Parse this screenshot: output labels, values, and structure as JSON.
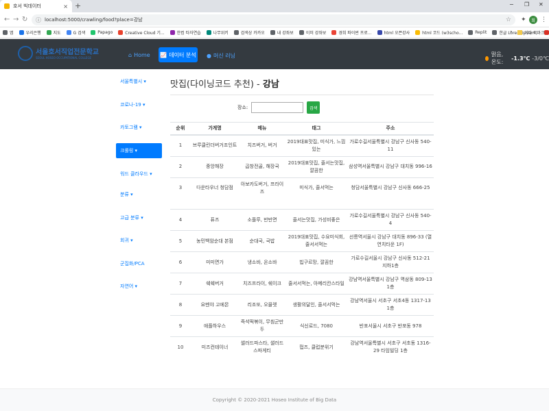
{
  "browser": {
    "tab_title": "호서 빅데이터",
    "tab_close": "×",
    "new_tab": "+",
    "url": "localhost:5000/crawling/food?place=강남",
    "window_minimize": "−",
    "window_restore": "❐",
    "window_close": "✕",
    "profile_initial": "희",
    "bookmarks": [
      {
        "label": "앱",
        "color": "#5f6368"
      },
      {
        "label": "우리은행",
        "color": "#1a73e8"
      },
      {
        "label": "지도",
        "color": "#34a853"
      },
      {
        "label": "G 검색",
        "color": "#4285f4"
      },
      {
        "label": "Papago",
        "color": "#21c56d"
      },
      {
        "label": "Creative Cloud 기...",
        "color": "#e8412c"
      },
      {
        "label": "한컴 타자연습",
        "color": "#8e24aa"
      },
      {
        "label": "나무위키",
        "color": "#00897b"
      },
      {
        "label": "검색상 카카오",
        "color": "#5f6368"
      },
      {
        "label": "내 강좌보",
        "color": "#5f6368"
      },
      {
        "label": "이미 강좌보",
        "color": "#5f6368"
      },
      {
        "label": "경희 파이썬 프로...",
        "color": "#ea4335"
      },
      {
        "label": "html 오픈강사",
        "color": "#3949ab"
      },
      {
        "label": "html 코드 (w3scho...",
        "color": "#fbbc04"
      },
      {
        "label": "Replit",
        "color": "#5f6368"
      },
      {
        "label": "한글 Lorem Ipsum...",
        "color": "#5f6368"
      },
      {
        "label": "ppt",
        "color": "#d93025"
      }
    ],
    "bookmarks_more": "»",
    "other_bookmarks": "기타 북마크"
  },
  "navbar": {
    "logo_ko": "서울호서직업전문학교",
    "logo_en": "SEOUL HOSEO OCCUPATIONAL COLLEGE",
    "home_label": "Home",
    "data_analysis_label": "데이터 분석",
    "ml_label": "머신 러닝",
    "weather_label": "맑음, 온도:",
    "temp_now": "-1.3℃",
    "temp_low": "-3/0℃"
  },
  "sidebar": {
    "items": [
      {
        "label": "서울특별시 ▾"
      },
      {
        "label": "코로나-19 ▾"
      },
      {
        "label": "카토그램 ▾"
      },
      {
        "label": "크롤링 ▾"
      },
      {
        "label": "워드 클라우드 ▾"
      },
      {
        "label": "분류 ▾"
      },
      {
        "label": "고급 분류 ▾"
      },
      {
        "label": "회귀 ▾"
      },
      {
        "label": "군집화/PCA"
      },
      {
        "label": "자연어 ▾"
      }
    ]
  },
  "main": {
    "title_prefix": "맛집(다이닝코드 추천) - ",
    "title_place": "강남",
    "search_label": "장소:",
    "search_value": "",
    "search_button": "검색",
    "columns": [
      "순위",
      "가게명",
      "메뉴",
      "태그",
      "주소"
    ],
    "rows_top": [
      {
        "rank": "1",
        "name": "브루클린더버거조인트",
        "menu": "치즈버거, 버거",
        "tags": "2019대표맛집, 미식가, 느낌있는",
        "addr": "가로수길서울특별시 강남구 신사동 540-11"
      },
      {
        "rank": "2",
        "name": "중앙해장",
        "menu": "곱창전골, 해장국",
        "tags": "2019대표맛집, 줄서는맛집, 깔끔한",
        "addr": "삼성역서울특별시 강남구 대치동 996-16"
      },
      {
        "rank": "3",
        "name": "다운타우너 청담점",
        "menu": "아보카도버거, 프라이즈",
        "tags": "미식가, 줄서먹는",
        "addr": "청담서울특별시 강남구 신사동 666-25"
      }
    ],
    "rows_bottom": [
      {
        "rank": "4",
        "name": "퓨즈",
        "menu": "소플루, 반반면",
        "tags": "줄서는맛집, 가성비좋은",
        "addr": "가로수길서울특별시 강남구 신사동 540-4"
      },
      {
        "rank": "5",
        "name": "농민백암순대 본점",
        "menu": "순대국, 국밥",
        "tags": "2019대표맛집, 수요미식회, 줄서서먹는",
        "addr": "선릉역서울시 강남구 대치동 896-33 (열연치타운 1F)"
      },
      {
        "rank": "6",
        "name": "미미면가",
        "menu": "냉소바, 온소바",
        "tags": "빕구르망, 깔끔한",
        "addr": "가로수길서울시 강남구 신사동 512-21 지하1층"
      },
      {
        "rank": "7",
        "name": "쉑쉑버거",
        "menu": "치즈프라이, 쉐이크",
        "tags": "줄서서먹는, 아메리칸스타일",
        "addr": "강남역서울특별시 강남구 역삼동 809-13 1층"
      },
      {
        "rank": "8",
        "name": "요멘야 고에몬",
        "menu": "리조또, 오믈렛",
        "tags": "생활의달인, 줄서서먹는",
        "addr": "강남역서울시 서초구 서초4동 1317-13 1층"
      },
      {
        "rank": "9",
        "name": "애플하우스",
        "menu": "즉석떡볶이, 무침군만두",
        "tags": "식신로드, 7080",
        "addr": "반포서울시 서초구 반포동 978"
      },
      {
        "rank": "10",
        "name": "미즈컨테이너",
        "menu": "샐러드파스타, 샐러드스파게티",
        "tags": "펍즈, 클럽분위기",
        "addr": "강남역서울특별시 서초구 서초동 1316-29 타임빌딩 1층"
      }
    ]
  },
  "footer": {
    "copyright": "Copyright © 2020-2021 Hoseo Institute of Big Data"
  }
}
